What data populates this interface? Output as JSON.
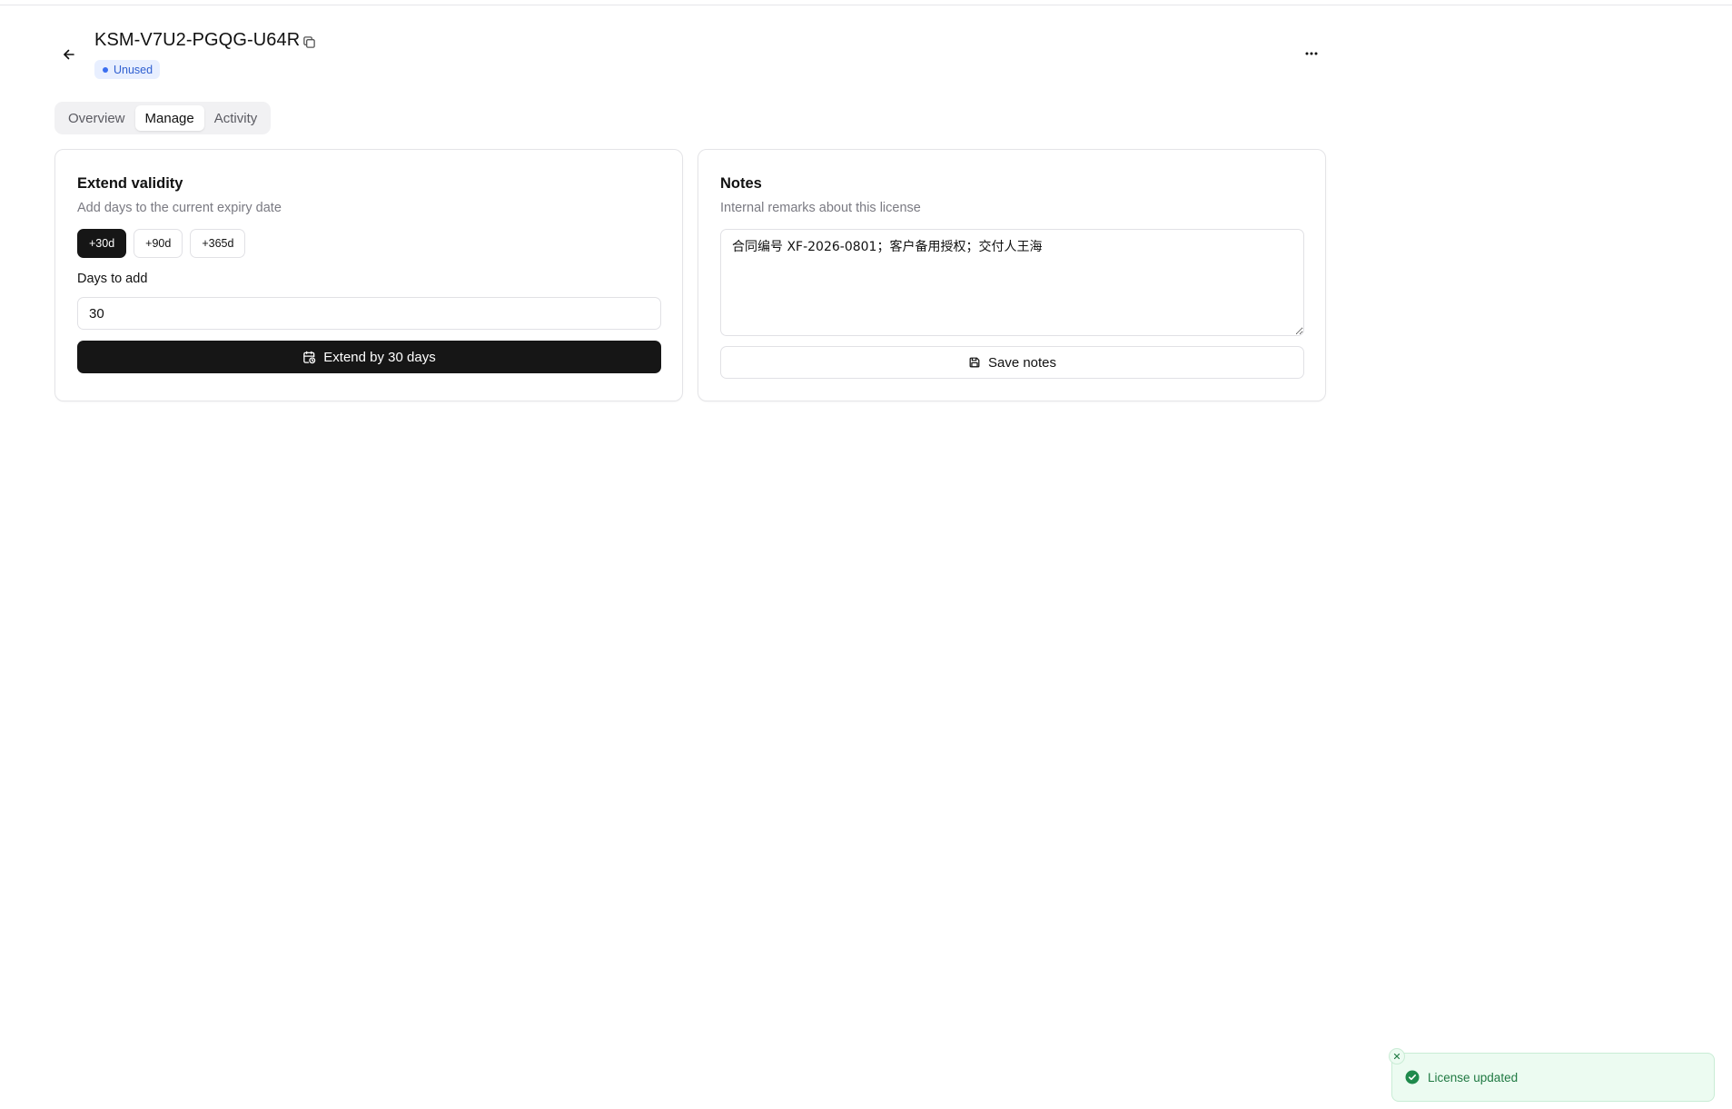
{
  "header": {
    "title": "KSM-V7U2-PGQG-U64R",
    "status": "Unused",
    "status_color": "#3b6ff0",
    "back_icon": "arrow-left-icon",
    "copy_icon": "copy-icon",
    "more_icon": "more-horizontal-icon"
  },
  "tabs": [
    {
      "label": "Overview",
      "active": false
    },
    {
      "label": "Manage",
      "active": true
    },
    {
      "label": "Activity",
      "active": false
    }
  ],
  "extend": {
    "title": "Extend validity",
    "subtitle": "Add days to the current expiry date",
    "presets": [
      {
        "label": "+30d",
        "active": true
      },
      {
        "label": "+90d",
        "active": false
      },
      {
        "label": "+365d",
        "active": false
      }
    ],
    "field_label": "Days to add",
    "days_value": "30",
    "button_label": "Extend by 30 days",
    "button_icon": "calendar-clock-icon"
  },
  "notes": {
    "title": "Notes",
    "subtitle": "Internal remarks about this license",
    "value": "合同编号 XF-2026-0801；客户备用授权；交付人王海",
    "button_label": "Save notes",
    "button_icon": "save-icon"
  },
  "toast": {
    "message": "License updated",
    "icon": "check-circle-icon",
    "close_icon": "close-icon",
    "color": "#207a43"
  }
}
